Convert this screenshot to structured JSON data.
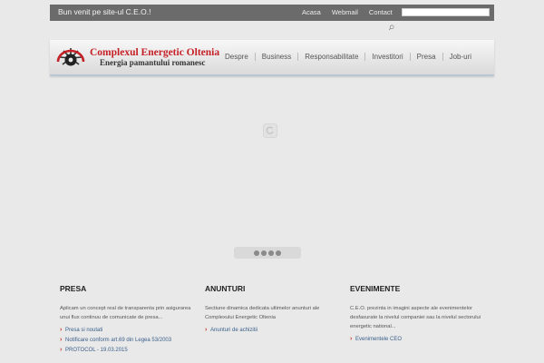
{
  "topbar": {
    "welcome": "Bun venit pe site-ul C.E.O.!",
    "links": {
      "home": "Acasa",
      "webmail": "Webmail",
      "contact": "Contact"
    },
    "search_value": ""
  },
  "brand": {
    "title": "Complexul Energetic Oltenia",
    "subtitle": "Energia pamantului romanesc",
    "accent_color": "#c52026"
  },
  "nav": {
    "items": [
      "Despre",
      "Business",
      "Responsabilitate",
      "Investitori",
      "Presa",
      "Job-uri"
    ]
  },
  "slider": {
    "dot_count": 4
  },
  "sections": [
    {
      "title": "PRESA",
      "description": "Aplicam un concept real de transparenta prin asigurarea unui flux continuu de comunicate de presa...",
      "links": [
        "Presa si noutati",
        "Notificare conform art.69 din Legea 53/2003",
        "PROTOCOL - 19.03.2015"
      ]
    },
    {
      "title": "ANUNTURI",
      "description": "Sectiune dinamica dedicata ultimelor anunturi ale Complexului Energetic Oltenia",
      "links": [
        "Anunturi de achizitii"
      ]
    },
    {
      "title": "EVENIMENTE",
      "description": "C.E.O. prezinta in imagini aspecte ale evenimentelor desfasurate la nivelul companiei sau la nivelul sectorului energetic national...",
      "links": [
        "Evenimentele CEO"
      ]
    }
  ],
  "icons": {
    "search": "search-icon",
    "logo": "logo-gear-icon",
    "loader": "loading-icon",
    "link_bullet": "chevron-right-icon"
  }
}
